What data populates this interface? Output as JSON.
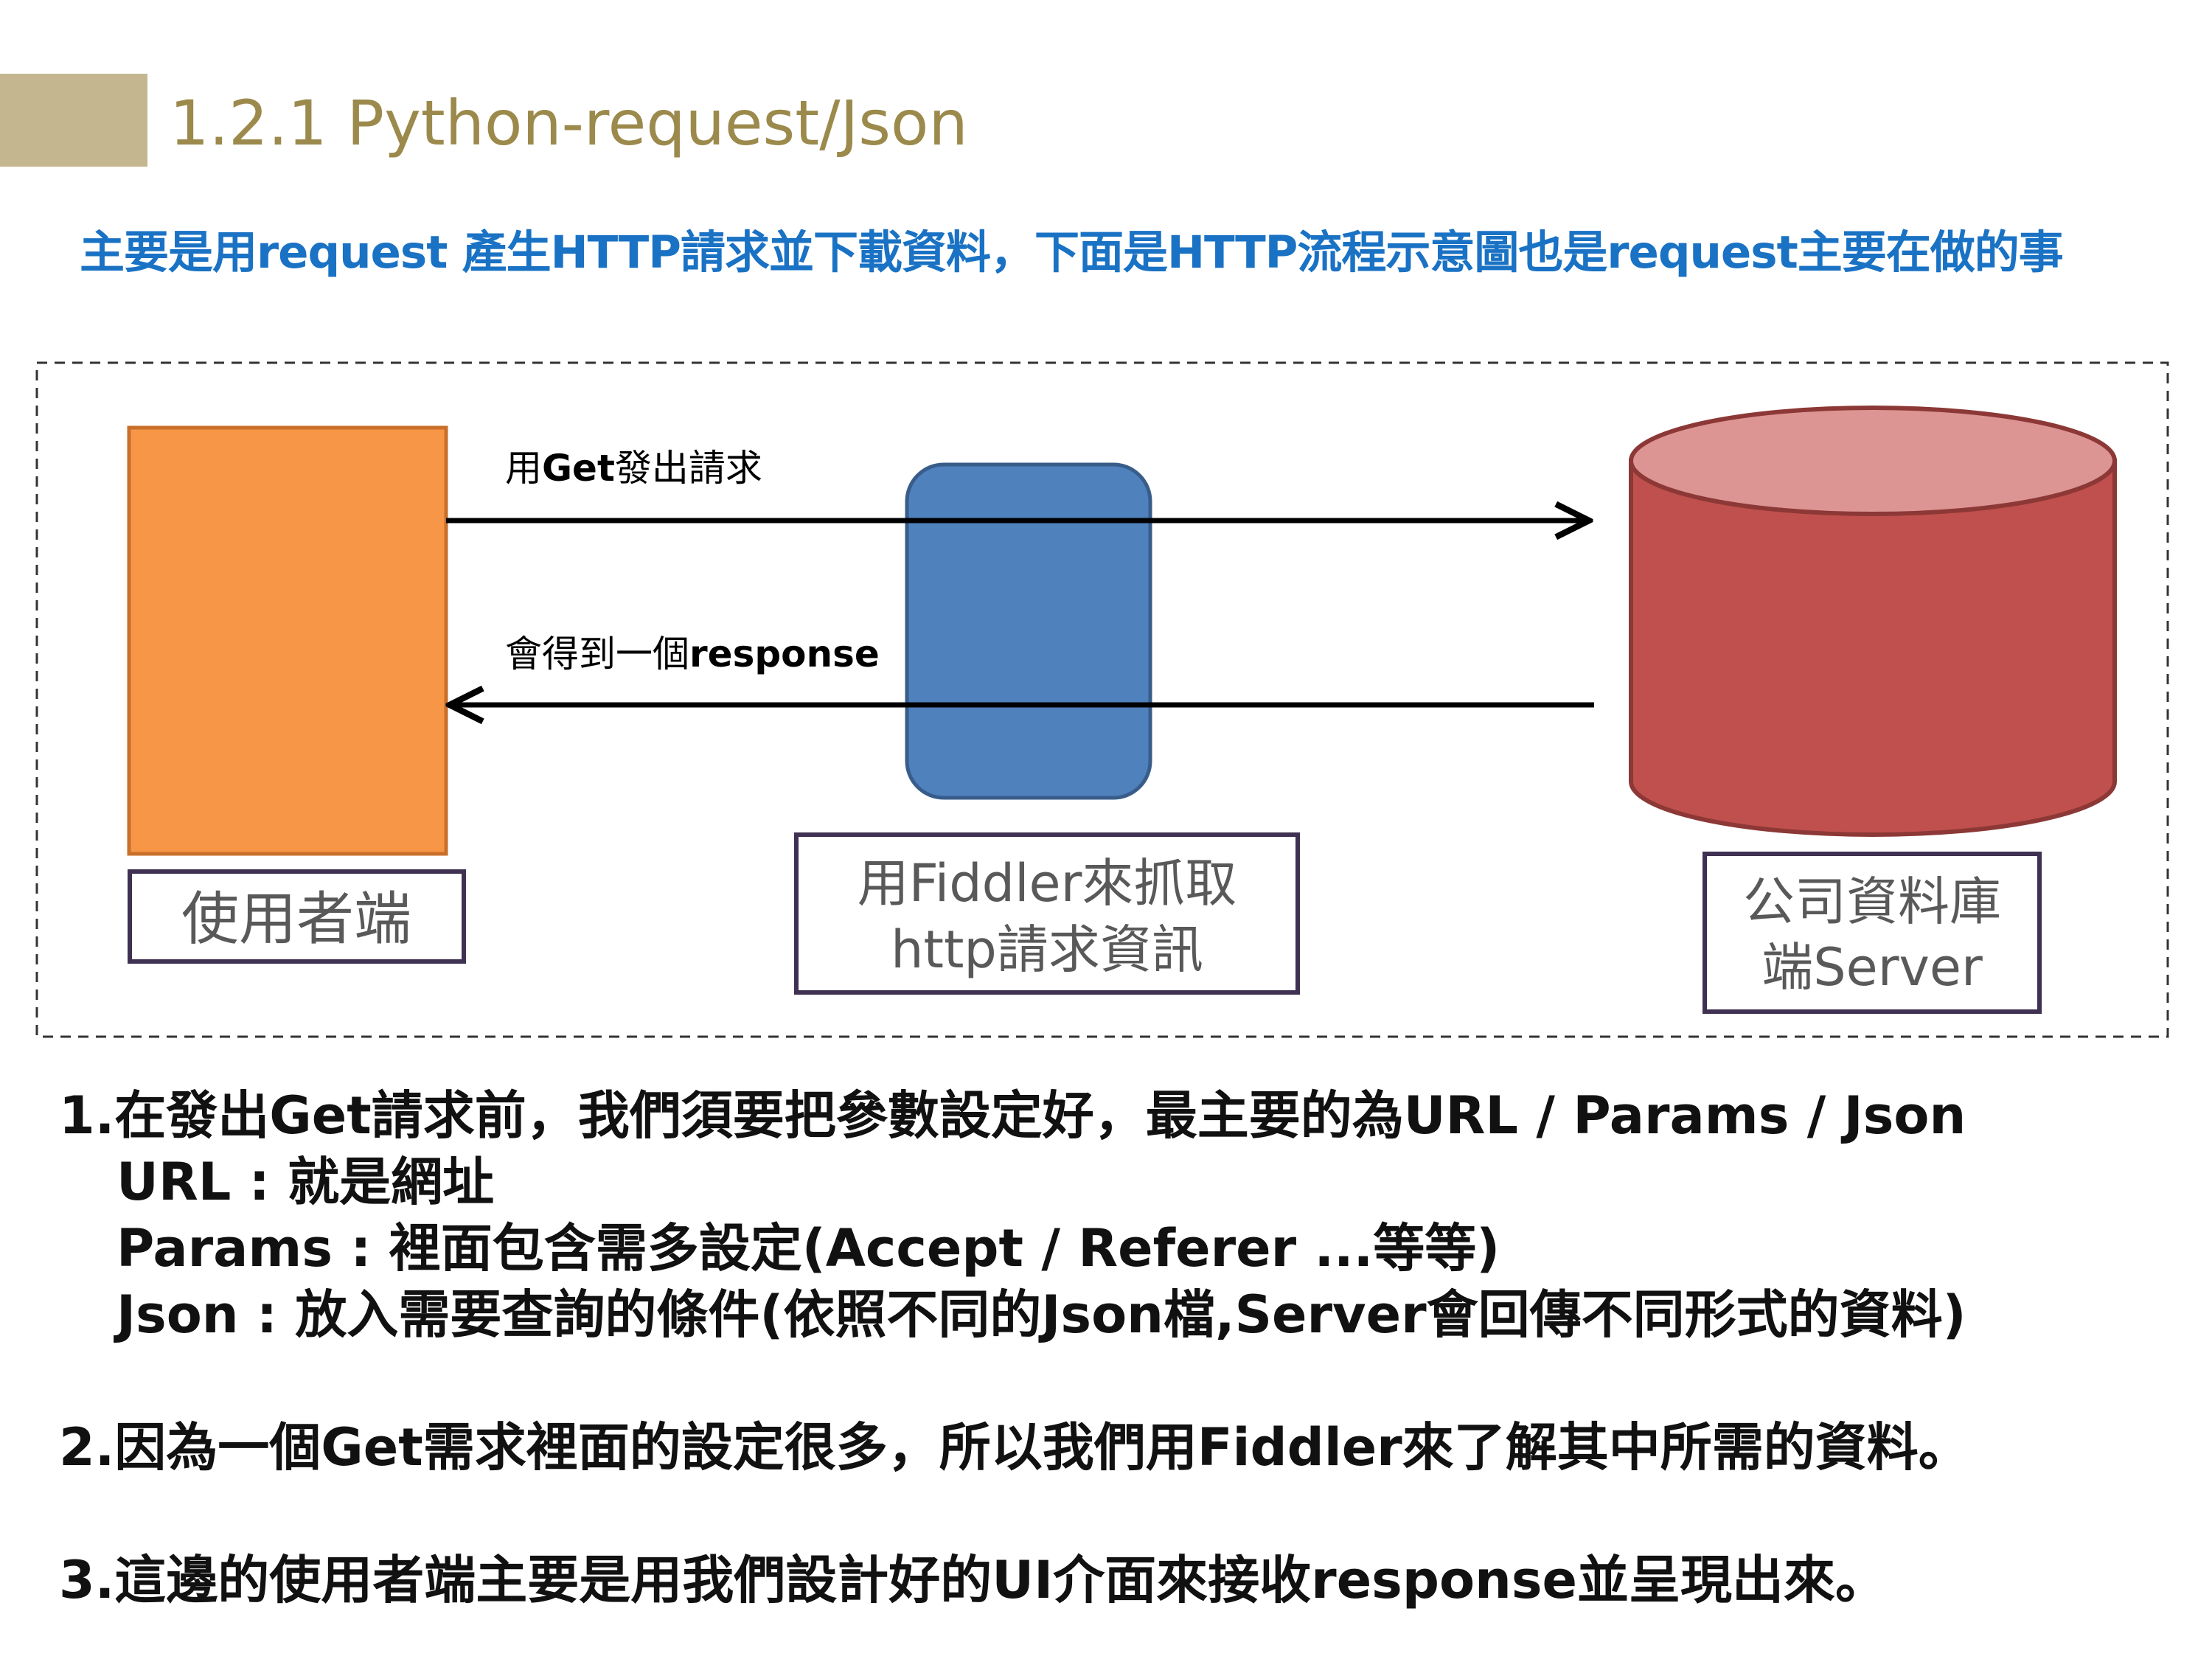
{
  "slide": {
    "title": "1.2.1 Python-request/Json",
    "subtitle": "主要是用request 產生HTTP請求並下載資料，下面是HTTP流程示意圖也是request主要在做的事"
  },
  "diagram": {
    "client_label": "使用者端",
    "fiddler_label_line1": "用Fiddler來抓取",
    "fiddler_label_line2": "http請求資訊",
    "server_label_line1": "公司資料庫",
    "server_label_line2": "端Server",
    "request_arrow_prefix": "用",
    "request_arrow_bold": "Get",
    "request_arrow_suffix": "發出請求",
    "response_arrow_prefix": "會得到一個",
    "response_arrow_bold": "response"
  },
  "notes": {
    "point1": "1.在發出Get請求前，我們須要把參數設定好，最主要的為URL / Params / Json",
    "point1_url": "URL : 就是網址",
    "point1_params": "Params : 裡面包含需多設定(Accept / Referer ...等等)",
    "point1_json": "Json : 放入需要查詢的條件(依照不同的Json檔,Server會回傳不同形式的資料)",
    "point2": "2.因為一個Get需求裡面的設定很多，所以我們用Fiddler來了解其中所需的資料。",
    "point3": "3.這邊的使用者端主要是用我們設計好的UI介面來接收response並呈現出來。"
  },
  "colors": {
    "title_bar": "#c4b78f",
    "title_text": "#9b8a4c",
    "subtitle_text": "#1a72c4",
    "client_fill": "#f79646",
    "client_stroke": "#c86f2a",
    "fiddler_fill": "#4f81bd",
    "fiddler_stroke": "#385d8a",
    "server_fill": "#c0504d",
    "server_top": "#dc9593",
    "server_stroke": "#8c3836",
    "label_border": "#3f3151",
    "label_text": "#595959"
  },
  "icons": {
    "client": "client-box",
    "fiddler": "fiddler-proxy-box",
    "server": "database-cylinder-icon"
  }
}
